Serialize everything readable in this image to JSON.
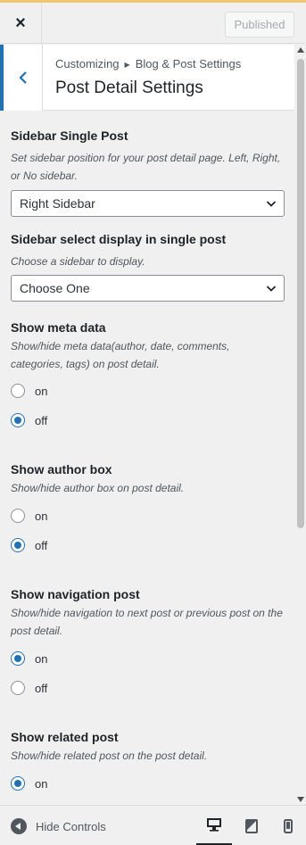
{
  "header": {
    "close_label": "×",
    "published_label": "Published"
  },
  "panel": {
    "crumb_root": "Customizing",
    "crumb_section": "Blog & Post Settings",
    "title": "Post Detail Settings"
  },
  "controls": {
    "sidebar_single": {
      "title": "Sidebar Single Post",
      "desc": "Set sidebar position for your post detail page. Left, Right, or No sidebar.",
      "value": "Right Sidebar"
    },
    "sidebar_select": {
      "title": "Sidebar select display in single post",
      "desc": "Choose a sidebar to display.",
      "value": "Choose One"
    },
    "meta": {
      "title": "Show meta data",
      "desc": "Show/hide meta data(author, date, comments, categories, tags) on post detail.",
      "on": "on",
      "off": "off",
      "selected": "off"
    },
    "author_box": {
      "title": "Show author box",
      "desc": "Show/hide author box on post detail.",
      "on": "on",
      "off": "off",
      "selected": "off"
    },
    "navigation": {
      "title": "Show navigation post",
      "desc": "Show/hide navigation to next post or previous post on the post detail.",
      "on": "on",
      "off": "off",
      "selected": "on"
    },
    "related": {
      "title": "Show related post",
      "desc": "Show/hide related post on the post detail.",
      "on": "on",
      "selected": "on"
    }
  },
  "footer": {
    "hide_controls": "Hide Controls",
    "devices": [
      "desktop-icon",
      "tablet-icon",
      "mobile-icon"
    ],
    "active_device": "desktop"
  },
  "colors": {
    "accent": "#2271b1",
    "background": "#f0f0f1",
    "top_bar": "#f0c674"
  }
}
